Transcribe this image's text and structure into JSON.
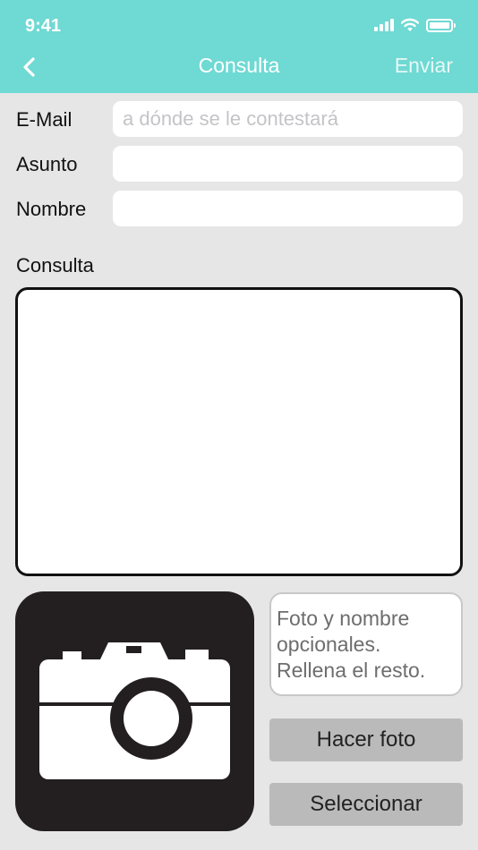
{
  "status": {
    "time": "9:41"
  },
  "nav": {
    "title": "Consulta",
    "send_label": "Enviar"
  },
  "form": {
    "email_label": "E-Mail",
    "email_placeholder": "a dónde se le contestará",
    "subject_label": "Asunto",
    "name_label": "Nombre",
    "query_label": "Consulta"
  },
  "photo": {
    "icon": "camera-icon",
    "hint": "Foto y nombre opcionales. Rellena el resto.",
    "take_photo_label": "Hacer foto",
    "select_label": "Seleccionar"
  },
  "colors": {
    "header": "#6fd9d3",
    "background": "#e6e6e6",
    "button": "#bababa",
    "photo_bg": "#231f20"
  }
}
